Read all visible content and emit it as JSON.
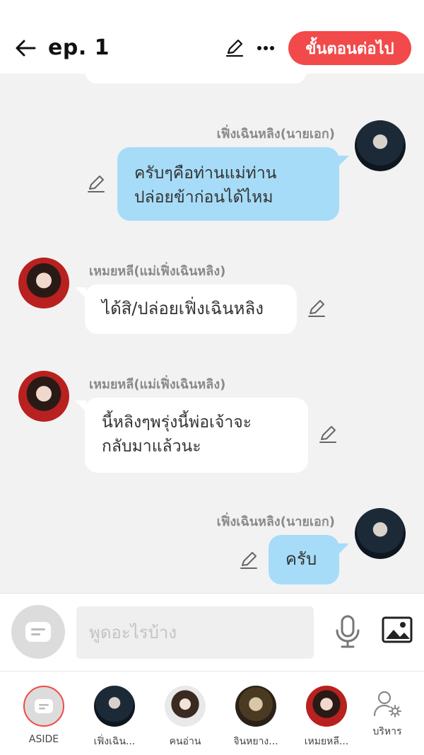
{
  "header": {
    "title": "ep. 1",
    "next_label": "ขั้นตอนต่อไป"
  },
  "messages": [
    {
      "side": "right",
      "name": "เฟิ่งเฉินหลิง(นายเอก)",
      "text": "ครับๆคือท่านแม่ท่าน\nปล่อยข้าก่อนได้ไหม",
      "avatar": "hero-avatar"
    },
    {
      "side": "left",
      "name": "เหมยหลี(แม่เฟิ่งเฉินหลิง)",
      "text": "ได้สิ/ปล่อยเฟิ่งเฉินหลิง",
      "avatar": "mother-avatar"
    },
    {
      "side": "left",
      "name": "เหมยหลี(แม่เฟิ่งเฉินหลิง)",
      "text": "นี้หลิงๆพรุ่งนี้พ่อเจ้าจะ\nกลับมาแล้วนะ",
      "avatar": "mother-avatar"
    },
    {
      "side": "right",
      "name": "เฟิ่งเฉินหลิง(นายเอก)",
      "text": "ครับ",
      "avatar": "hero-avatar"
    }
  ],
  "input": {
    "placeholder": "พูดอะไรบ้าง"
  },
  "characters": [
    {
      "label": "ASIDE"
    },
    {
      "label": "เฟิ่งเฉิน..."
    },
    {
      "label": "คนอ่าน"
    },
    {
      "label": "จินหยาง..."
    },
    {
      "label": "เหมยหลี..."
    },
    {
      "label": "บริหาร"
    }
  ],
  "colors": {
    "accent": "#f24a4a",
    "bubble_blue": "#a6dcf8",
    "bubble_white": "#ffffff",
    "background": "#f2f2f2"
  }
}
